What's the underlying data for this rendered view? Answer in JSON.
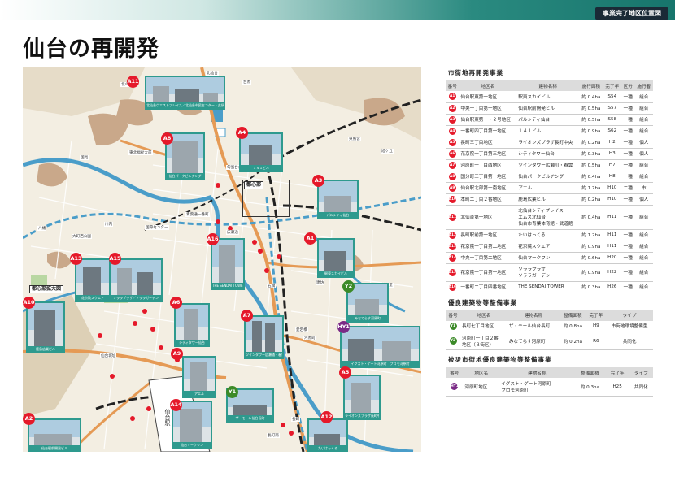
{
  "header": {
    "badge": "事業完了地区位置図",
    "title": "仙台の再開発"
  },
  "colors": {
    "accent_teal": "#2e9a8e",
    "marker_red": "#e5192a",
    "marker_green": "#3c8a28",
    "marker_purple": "#7a2a86",
    "road_orange": "#e59a55",
    "river_blue": "#4a9dc9"
  },
  "map": {
    "station": "仙台駅",
    "center_area": "都心部",
    "park_label": "都心部拡大図",
    "markers": [
      {
        "id": "A11",
        "color": "red"
      },
      {
        "id": "A8",
        "color": "red"
      },
      {
        "id": "A4",
        "color": "red"
      },
      {
        "id": "A3",
        "color": "red"
      },
      {
        "id": "A1",
        "color": "red"
      },
      {
        "id": "A16",
        "color": "red"
      },
      {
        "id": "A13",
        "color": "red"
      },
      {
        "id": "A15",
        "color": "red"
      },
      {
        "id": "A10",
        "color": "red"
      },
      {
        "id": "A6",
        "color": "red"
      },
      {
        "id": "A7",
        "color": "red"
      },
      {
        "id": "A9",
        "color": "red"
      },
      {
        "id": "A14",
        "color": "red"
      },
      {
        "id": "A2",
        "color": "red"
      },
      {
        "id": "A12",
        "color": "red"
      },
      {
        "id": "A5",
        "color": "red"
      },
      {
        "id": "Y1",
        "color": "green"
      },
      {
        "id": "Y2",
        "color": "green"
      },
      {
        "id": "HY1",
        "color": "purple"
      }
    ],
    "photos": [
      {
        "ref": "A11",
        "caption": "北仙台ウエストプレイス／北仙台市民センター・支所等"
      },
      {
        "ref": "A8",
        "caption": "仙台パークビルヂング"
      },
      {
        "ref": "A4",
        "caption": "１４１ビル"
      },
      {
        "ref": "A3",
        "caption": "パルシティ仙台"
      },
      {
        "ref": "A1",
        "caption": "駅東スカイビル"
      },
      {
        "ref": "A16",
        "caption": "THE SENDAI TOWER"
      },
      {
        "ref": "A13",
        "caption": "花京院スクエア"
      },
      {
        "ref": "A15",
        "caption": "ソララプラザ／ソララガーデン"
      },
      {
        "ref": "A10",
        "caption": "鹿島広業ビル"
      },
      {
        "ref": "A6",
        "caption": "シティタワー仙台"
      },
      {
        "ref": "A7",
        "caption": "ツインタワー広瀬通・春雲"
      },
      {
        "ref": "A9",
        "caption": "アエル"
      },
      {
        "ref": "Y2",
        "caption": "みなてらす河原町"
      },
      {
        "ref": "HY1",
        "caption": "イグスト・ゲート河原町　プロモ河原町"
      },
      {
        "ref": "A5",
        "caption": "ライオンズプラザ長町中央"
      },
      {
        "ref": "Y1",
        "caption": "ザ・モール仙台長町"
      },
      {
        "ref": "A14",
        "caption": "仙台マークワン"
      },
      {
        "ref": "A12",
        "caption": "たいはっくる"
      },
      {
        "ref": "A2",
        "caption": "仙台駅前開発ビル"
      }
    ],
    "place_labels": [
      "北四番丁",
      "北仙台",
      "北仙台",
      "勾当台公園",
      "仙台",
      "広瀬通",
      "五橋",
      "愛宕橋",
      "長町一丁目",
      "長町",
      "宮城野通",
      "榴岡",
      "薬師堂",
      "連坊",
      "河原町",
      "長町南",
      "北山",
      "東北福祉大前",
      "国見",
      "八幡",
      "大町西公園",
      "青葉通一番町",
      "青葉山",
      "川内",
      "国際センター",
      "仙台城址",
      "東照宮",
      "台原",
      "旭ケ丘"
    ]
  },
  "tables": {
    "urban": {
      "title": "市街地再開発事業",
      "headers": [
        "番号",
        "地区名",
        "建物名称",
        "施行面積",
        "完了年",
        "区分",
        "施行者"
      ],
      "rows": [
        [
          "A1",
          "仙台駅東第一地区",
          "駅東スカイビル",
          "約 0.4ha",
          "S54",
          "一種",
          "組合"
        ],
        [
          "A2",
          "中央一丁目第一地区",
          "仙台駅前開発ビル",
          "約 0.5ha",
          "S57",
          "一種",
          "組合"
        ],
        [
          "A3",
          "仙台駅東第一・２号地区",
          "パルシティ仙台",
          "約 0.5ha",
          "S58",
          "一種",
          "組合"
        ],
        [
          "A4",
          "一番町四丁目第一地区",
          "１４１ビル",
          "約 0.9ha",
          "S62",
          "一種",
          "組合"
        ],
        [
          "A5",
          "長町三丁目地区",
          "ライオンズプラザ長町中央",
          "約 0.2ha",
          "H2",
          "一種",
          "個人"
        ],
        [
          "A6",
          "花京院一丁目第三地区",
          "シティタワー仙台",
          "約 0.3ha",
          "H3",
          "一種",
          "個人"
        ],
        [
          "A7",
          "河原町一丁目西地区",
          "ツインタワー広瀬川・春雲",
          "約 0.5ha",
          "H7",
          "一種",
          "組合"
        ],
        [
          "A8",
          "国分町三丁目第一地区",
          "仙台パークビルヂング",
          "約 0.4ha",
          "H8",
          "一種",
          "組合"
        ],
        [
          "A9",
          "仙台駅北部第一南地区",
          "アエル",
          "約 1.7ha",
          "H10",
          "二種",
          "市"
        ],
        [
          "A10",
          "本町二丁目２番地区",
          "鹿島広業ビル",
          "約 0.2ha",
          "H10",
          "一種",
          "個人"
        ],
        [
          "A11",
          "北仙台第一地区",
          "北仙台シティプレイス\nエムズ北仙台\n仙台市青葉体育館・武道館",
          "約 0.4ha",
          "H11",
          "一種",
          "組合"
        ],
        [
          "A12",
          "長町駅前第一地区",
          "たいはっくる",
          "約 1.2ha",
          "H11",
          "一種",
          "組合"
        ],
        [
          "A13",
          "花京院一丁目第二地区",
          "花京院スクエア",
          "約 0.9ha",
          "H11",
          "一種",
          "組合"
        ],
        [
          "A14",
          "中央一丁目第二地区",
          "仙台マークワン",
          "約 0.6ha",
          "H20",
          "一種",
          "組合"
        ],
        [
          "A15",
          "花京院一丁目第一地区",
          "ソララプラザ\nソララガーデン",
          "約 0.9ha",
          "H22",
          "一種",
          "組合"
        ],
        [
          "A16",
          "一番町二丁目四番地区",
          "THE SENDAI TOWER",
          "約 0.3ha",
          "H26",
          "一種",
          "組合"
        ]
      ]
    },
    "good": {
      "title": "優良建築物等整備事業",
      "headers": [
        "番号",
        "地区名",
        "建物名称",
        "整備面積",
        "完了年",
        "タイプ"
      ],
      "rows": [
        [
          "Y1",
          "長町七丁目地区",
          "ザ・モール仙台長町",
          "約 0.8ha",
          "H9",
          "市街地環境整備型"
        ],
        [
          "Y2",
          "河原町一丁目２番\n地区（Ｂ街区）",
          "みなてらす河原町",
          "約 0.2ha",
          "R6",
          "共同化"
        ]
      ]
    },
    "disaster": {
      "title": "被災市街地優良建築物等整備事業",
      "headers": [
        "番号",
        "地区名",
        "建物名称",
        "整備面積",
        "完了年",
        "タイプ"
      ],
      "rows": [
        [
          "HY1",
          "河原町地区",
          "イグスト・ゲート河原町\nプロモ河原町",
          "約 0.3ha",
          "H25",
          "共同化"
        ]
      ]
    }
  }
}
